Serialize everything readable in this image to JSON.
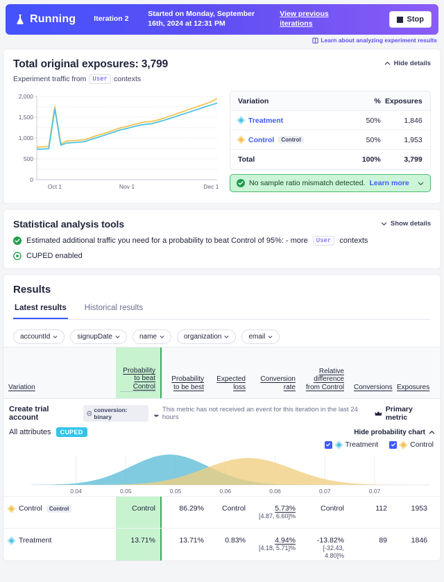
{
  "banner": {
    "status": "Running",
    "status_icon": "flask-icon",
    "iteration": "Iteration 2",
    "started": "Started on Monday, September 16th, 2024 at 12:31 PM",
    "view_previous": "View previous iterations",
    "stop_label": "Stop",
    "gradient_from": "#4353ff",
    "gradient_to": "#8b5cf6"
  },
  "learn_link": {
    "label": "Learn about analyzing experiment results",
    "icon": "book-icon",
    "color": "#5b4ef3"
  },
  "exposures": {
    "title": "Total original exposures: 3,799",
    "subtitle_prefix": "Experiment traffic from",
    "context_chip": "User",
    "subtitle_suffix": "contexts",
    "toggle_label": "Hide details",
    "toggle_icon": "chevron-up-icon",
    "table": {
      "headers": [
        "Variation",
        "%",
        "Exposures"
      ],
      "rows": [
        {
          "name": "Treatment",
          "tag": "",
          "pct": "50%",
          "exposures": "1,846",
          "color": "#4dc3e0"
        },
        {
          "name": "Control",
          "tag": "Control",
          "pct": "50%",
          "exposures": "1,953",
          "color": "#f2c14e"
        }
      ],
      "total": {
        "label": "Total",
        "pct": "100%",
        "exposures": "3,799"
      }
    },
    "srm": {
      "icon": "check-circle-icon",
      "text": "No sample ratio mismatch detected.",
      "link": "Learn more",
      "chevron": "chevron-down-icon",
      "bg": "#ccf5d8",
      "border": "#49b96a"
    }
  },
  "chart_data": [
    {
      "type": "line",
      "title": "Total original exposures: 3,799",
      "xlabel": "",
      "ylabel": "",
      "ylim": [
        0,
        2000
      ],
      "yticks": [
        "0",
        "500",
        "1,000",
        "1,500",
        "2,000"
      ],
      "xticks": [
        "Oct 1",
        "Nov 1",
        "Dec 1"
      ],
      "grid": true,
      "legend_position": "none",
      "series": [
        {
          "name": "Control",
          "color": "#f2c14e",
          "values": [
            780,
            790,
            800,
            1750,
            860,
            930,
            935,
            950,
            960,
            1010,
            1060,
            1100,
            1150,
            1200,
            1250,
            1280,
            1320,
            1355,
            1390,
            1395,
            1430,
            1470,
            1520,
            1570,
            1620,
            1670,
            1720,
            1770,
            1820,
            1870,
            1950
          ]
        },
        {
          "name": "Treatment",
          "color": "#4dc3e0",
          "values": [
            730,
            735,
            745,
            1700,
            830,
            880,
            890,
            900,
            915,
            965,
            1010,
            1055,
            1105,
            1150,
            1200,
            1230,
            1270,
            1305,
            1330,
            1340,
            1380,
            1420,
            1465,
            1510,
            1560,
            1605,
            1655,
            1700,
            1750,
            1795,
            1840
          ]
        }
      ]
    },
    {
      "type": "area",
      "title": "Probability density of conversion rate",
      "xlabel": "",
      "ylabel": "",
      "xticks": [
        "0.04",
        "0.05",
        "0.05",
        "0.06",
        "0.06",
        "0.07",
        "0.07"
      ],
      "grid": false,
      "legend_position": "top-right",
      "series": [
        {
          "name": "Treatment",
          "color": "#5cbdd6",
          "peak_x": 0.0494,
          "sd": 0.0039,
          "ci": [
            0.0418,
            0.0571
          ]
        },
        {
          "name": "Control",
          "color": "#f0ce80",
          "peak_x": 0.0573,
          "sd": 0.0044,
          "ci": [
            0.0487,
            0.066
          ]
        }
      ]
    }
  ],
  "stats": {
    "title": "Statistical analysis tools",
    "toggle_label": "Show details",
    "toggle_icon": "chevron-down-icon",
    "line1_prefix": "Estimated additional traffic you need for a probability to beat Control of 95%: - more",
    "line1_chip": "User",
    "line1_suffix": "contexts",
    "line1_icon": "check-circle-icon",
    "line2": "CUPED enabled",
    "line2_icon": "target-icon"
  },
  "results": {
    "title": "Results",
    "tabs": [
      {
        "label": "Latest results",
        "active": true
      },
      {
        "label": "Historical results",
        "active": false
      }
    ],
    "chips": [
      "accountId",
      "signupDate",
      "name",
      "organization",
      "email"
    ],
    "headers": {
      "variation": "Variation",
      "prob_beat_control": "Probability to beat Control",
      "prob_be_best": "Probability to be best",
      "expected_loss": "Expected loss",
      "conversion_rate": "Conversion rate",
      "relative_diff": "Relative difference from Control",
      "conversions": "Conversions",
      "exposures": "Exposures"
    },
    "metric": {
      "name": "Create trial account",
      "badge": "conversion: binary",
      "badge_icon": "circle-slash-icon",
      "warning": "This metric has not received an event for this iteration in the last 24 hours",
      "warning_icon": "bell-icon",
      "primary": "Primary metric",
      "primary_icon": "crown-icon"
    },
    "attributes": {
      "label": "All attributes",
      "cuped": "CUPED",
      "cuped_color": "#35c3ea",
      "hide_chart": "Hide probability chart",
      "hide_chart_icon": "chevron-up-icon"
    },
    "legend": [
      {
        "label": "Treatment",
        "checked": true,
        "color": "#4dc3e0"
      },
      {
        "label": "Control",
        "checked": true,
        "color": "#f2c14e"
      }
    ],
    "rows": [
      {
        "name": "Control",
        "tag": "Control",
        "color": "#f2c14e",
        "prob_beat_control": "Control",
        "prob_be_best": "86.29%",
        "expected_loss": "Control",
        "conversion_rate": "5.73%",
        "conversion_ci": "[4.87, 6.60]%",
        "relative_diff": "Control",
        "relative_ci": "",
        "conversions": "112",
        "exposures": "1953"
      },
      {
        "name": "Treatment",
        "tag": "",
        "color": "#4dc3e0",
        "prob_beat_control": "13.71%",
        "prob_be_best": "13.71%",
        "expected_loss": "0.83%",
        "conversion_rate": "4.94%",
        "conversion_ci": "[4.18, 5.71]%",
        "relative_diff": "-13.82%",
        "relative_ci": "[-32.43, 4.80]%",
        "conversions": "89",
        "exposures": "1846"
      }
    ],
    "highlight_color": "#c8f3cf",
    "highlight_border": "#3fa95d"
  }
}
